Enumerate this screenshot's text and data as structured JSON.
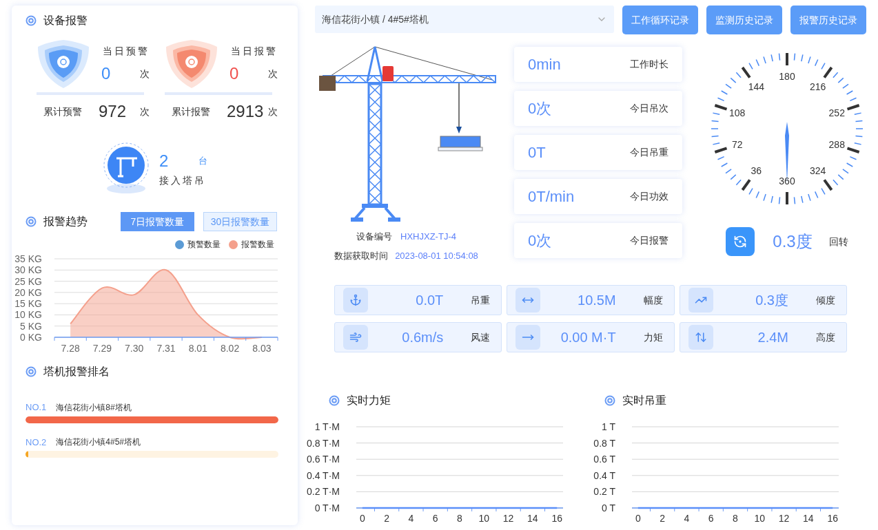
{
  "alarm_panel": {
    "title": "设备报警",
    "summary": [
      {
        "kind": "warning",
        "today_label": "当日预警",
        "today_value": "0",
        "today_unit": "次",
        "total_label": "累计预警",
        "total_value": "972",
        "total_unit": "次"
      },
      {
        "kind": "alarm",
        "today_label": "当日报警",
        "today_value": "0",
        "today_unit": "次",
        "total_label": "累计报警",
        "total_value": "2913",
        "total_unit": "次"
      }
    ],
    "connected": {
      "value": "2",
      "unit": "台",
      "label": "接入塔吊"
    }
  },
  "trend": {
    "title": "报警趋势",
    "tabs": [
      {
        "label": "7日报警数量",
        "selected": true
      },
      {
        "label": "30日报警数量",
        "selected": false
      }
    ],
    "chart_data": {
      "type": "area",
      "grid": true,
      "ylim": [
        0,
        35
      ],
      "categories": [
        "7.28",
        "7.29",
        "7.30",
        "7.31",
        "8.01",
        "8.02",
        "8.03"
      ],
      "series": [
        {
          "name": "预警数量",
          "color": "#5b9bd5",
          "values": [
            null,
            null,
            null,
            null,
            null,
            null,
            null
          ]
        },
        {
          "name": "报警数量",
          "color": "#f4a08c",
          "values": [
            6,
            22,
            19,
            30,
            10,
            0,
            0
          ]
        }
      ],
      "yticks": [
        {
          "value": 0,
          "label": "0 KG"
        },
        {
          "value": 5,
          "label": "5 KG"
        },
        {
          "value": 10,
          "label": "10 KG"
        },
        {
          "value": 15,
          "label": "15 KG"
        },
        {
          "value": 20,
          "label": "20 KG"
        },
        {
          "value": 25,
          "label": "25 KG"
        },
        {
          "value": 30,
          "label": "30 KG"
        },
        {
          "value": 35,
          "label": "35 KG"
        }
      ]
    }
  },
  "ranking": {
    "title": "塔机报警排名",
    "items": [
      {
        "rank": "NO.1",
        "name": "海信花街小镇8#塔机",
        "level": 1,
        "color": "#f26749"
      },
      {
        "rank": "NO.2",
        "name": "海信花街小镇4#5#塔机",
        "level": 0.01,
        "color": "#f5a623"
      }
    ]
  },
  "device_select": {
    "value": "海信花街小镇 / 4#5#塔机"
  },
  "buttons": [
    "工作循环记录",
    "监测历史记录",
    "报警历史记录"
  ],
  "device": {
    "id_label": "设备编号",
    "id": "HXHJXZ-TJ-4",
    "time_label": "数据获取时间",
    "time": "2023-08-01 10:54:08"
  },
  "stats": [
    {
      "value": "0min",
      "label": "工作时长"
    },
    {
      "value": "0次",
      "label": "今日吊次"
    },
    {
      "value": "0T",
      "label": "今日吊重"
    },
    {
      "value": "0T/min",
      "label": "今日功效"
    },
    {
      "value": "0次",
      "label": "今日报警"
    }
  ],
  "gauge": {
    "labels": [
      "36",
      "72",
      "108",
      "144",
      "180",
      "216",
      "252",
      "288",
      "324",
      "360"
    ]
  },
  "rotation": {
    "value": "0.3度",
    "label": "回转"
  },
  "sensors": [
    {
      "kind": "load",
      "value": "0.0T",
      "label": "吊重"
    },
    {
      "kind": "range",
      "value": "10.5M",
      "label": "幅度"
    },
    {
      "kind": "tilt",
      "value": "0.3度",
      "label": "倾度"
    },
    {
      "kind": "wind",
      "value": "0.6m/s",
      "label": "风速"
    },
    {
      "kind": "moment",
      "value": "0.00 M·T",
      "label": "力矩"
    },
    {
      "kind": "height",
      "value": "2.4M",
      "label": "高度"
    }
  ],
  "realtime": [
    {
      "title": "实时力矩",
      "chart_data": {
        "type": "line",
        "grid": true,
        "categories": [
          "0",
          null,
          "2",
          null,
          "4",
          null,
          "6",
          null,
          "8",
          null,
          "10",
          null,
          "12",
          null,
          "14",
          null,
          "16"
        ],
        "series": [
          {
            "color": "#5b8ff9",
            "values": [
              0,
              0,
              0,
              0,
              0,
              0,
              0,
              0,
              0,
              0,
              0,
              0,
              0,
              0,
              0,
              0,
              0
            ]
          }
        ],
        "ylim": [
          0,
          1
        ],
        "yticks": [
          {
            "value": 0,
            "label": "0 T·M"
          },
          {
            "value": 0.2,
            "label": "0.2 T·M"
          },
          {
            "value": 0.4,
            "label": "0.4 T·M"
          },
          {
            "value": 0.6,
            "label": "0.6 T·M"
          },
          {
            "value": 0.8,
            "label": "0.8 T·M"
          },
          {
            "value": 1,
            "label": "1 T·M"
          }
        ]
      }
    },
    {
      "title": "实时吊重",
      "chart_data": {
        "type": "line",
        "grid": true,
        "categories": [
          "0",
          null,
          "2",
          null,
          "4",
          null,
          "6",
          null,
          "8",
          null,
          "10",
          null,
          "12",
          null,
          "14",
          null,
          "16"
        ],
        "series": [
          {
            "color": "#5b8ff9",
            "values": [
              0,
              0,
              0,
              0,
              0,
              0,
              0,
              0,
              0,
              0,
              0,
              0,
              0,
              0,
              0,
              0,
              0
            ]
          }
        ],
        "ylim": [
          0,
          1
        ],
        "yticks": [
          {
            "value": 0,
            "label": "0 T"
          },
          {
            "value": 0.2,
            "label": "0.2 T"
          },
          {
            "value": 0.4,
            "label": "0.4 T"
          },
          {
            "value": 0.6,
            "label": "0.6 T"
          },
          {
            "value": 0.8,
            "label": "0.8 T"
          },
          {
            "value": 1,
            "label": "1 T"
          }
        ]
      }
    }
  ]
}
